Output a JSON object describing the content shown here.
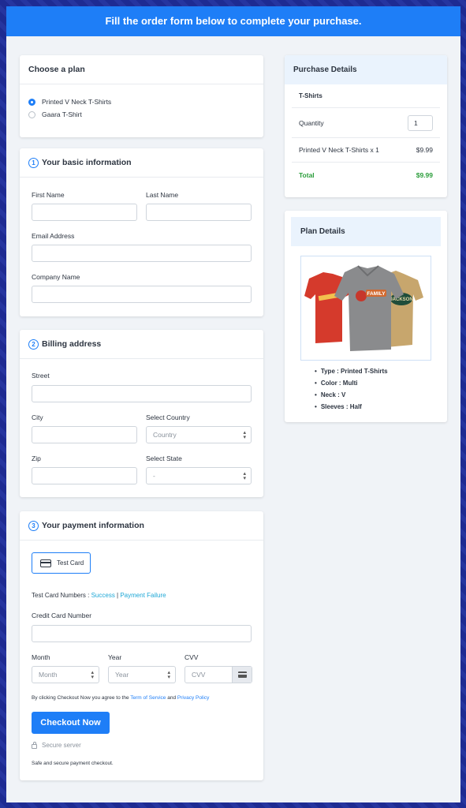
{
  "banner": {
    "text": "Fill the order form below to complete your purchase."
  },
  "plan": {
    "title": "Choose a plan",
    "options": [
      {
        "label": "Printed V Neck T-Shirts",
        "selected": true
      },
      {
        "label": "Gaara T-Shirt",
        "selected": false
      }
    ]
  },
  "basic": {
    "step": "1",
    "title": "Your basic information",
    "first_name_label": "First Name",
    "last_name_label": "Last Name",
    "email_label": "Email Address",
    "company_label": "Company Name"
  },
  "billing": {
    "step": "2",
    "title": "Billing address",
    "street_label": "Street",
    "city_label": "City",
    "country_label": "Select Country",
    "country_value": "Country",
    "zip_label": "Zip",
    "state_label": "Select State",
    "state_value": "-"
  },
  "payment": {
    "step": "3",
    "title": "Your payment information",
    "test_card_label": "Test Card",
    "test_numbers_prefix": "Test Card Numbers : ",
    "success_link": "Success",
    "separator": " | ",
    "failure_link": "Payment Failure",
    "cc_label": "Credit Card Number",
    "month_label": "Month",
    "month_value": "Month",
    "year_label": "Year",
    "year_value": "Year",
    "cvv_label": "CVV",
    "cvv_placeholder": "CVV",
    "agree_prefix": "By clicking Checkout Now you agree to the ",
    "terms_link": "Term of Service",
    "agree_and": " and ",
    "privacy_link": "Privacy Policy",
    "checkout_button": "Checkout Now",
    "secure_server": "Secure server",
    "secure_note": "Safe and secure payment checkout."
  },
  "purchase": {
    "title": "Purchase Details",
    "product_group": "T-Shirts",
    "quantity_label": "Quantity",
    "quantity_value": "1",
    "item_label": "Printed V Neck T-Shirts x 1",
    "item_price": "$9.99",
    "total_label": "Total",
    "total_value": "$9.99"
  },
  "plan_details": {
    "title": "Plan Details",
    "image_text_family": "FAMILY",
    "image_text_jackson": "JACKSON",
    "features": [
      "Type : Printed T-Shirts",
      "Color : Multi",
      "Neck : V",
      "Sleeves : Half"
    ]
  },
  "colors": {
    "accent": "#1e7ef7",
    "total_green": "#2a9d3a",
    "link_cyan": "#1ea7d6"
  }
}
